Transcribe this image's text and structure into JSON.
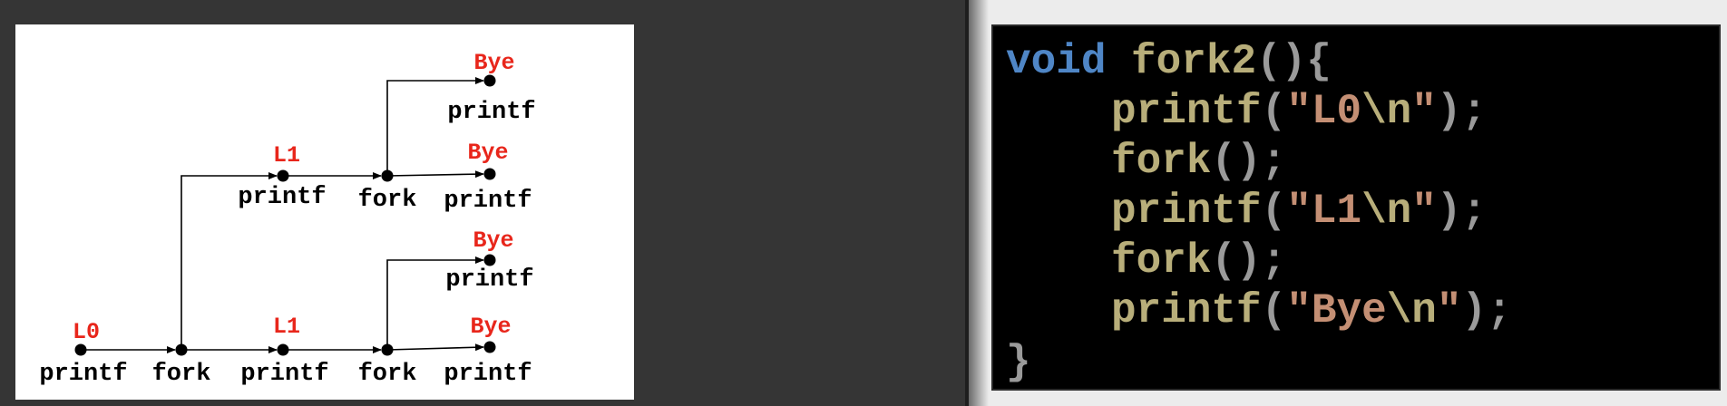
{
  "diagram": {
    "nodes": [
      {
        "id": "n0",
        "label": "printf",
        "output": "L0"
      },
      {
        "id": "n1",
        "label": "fork",
        "output": ""
      },
      {
        "id": "n2",
        "label": "printf",
        "output": "L1"
      },
      {
        "id": "n3",
        "label": "fork",
        "output": ""
      },
      {
        "id": "n4",
        "label": "printf",
        "output": "Bye"
      },
      {
        "id": "n5",
        "label": "printf",
        "output": "Bye"
      },
      {
        "id": "n6",
        "label": "printf",
        "output": "L1"
      },
      {
        "id": "n7",
        "label": "fork",
        "output": ""
      },
      {
        "id": "n8",
        "label": "printf",
        "output": "Bye"
      },
      {
        "id": "n9",
        "label": "printf",
        "output": "Bye"
      }
    ],
    "edges": [
      {
        "from": "n0",
        "to": "n1"
      },
      {
        "from": "n1",
        "to": "n2"
      },
      {
        "from": "n2",
        "to": "n3"
      },
      {
        "from": "n3",
        "to": "n4"
      },
      {
        "from": "n3",
        "to": "n5"
      },
      {
        "from": "n1",
        "to": "n6"
      },
      {
        "from": "n6",
        "to": "n7"
      },
      {
        "from": "n7",
        "to": "n8"
      },
      {
        "from": "n7",
        "to": "n9"
      }
    ]
  },
  "code": {
    "keyword_void": "void",
    "func_name": "fork2",
    "parens": "()",
    "open_brace": "{",
    "printf": "printf",
    "fork": "fork",
    "lparen": "(",
    "rparen": ")",
    "empty_parens": "()",
    "semicolon": ";",
    "quote": "\"",
    "str_l0": "L0",
    "str_l1": "L1",
    "str_bye": "Bye",
    "escape_n": "\\n",
    "close_brace": "}"
  },
  "colors": {
    "output_text": "#e8261b",
    "keyword": "#4f86c6",
    "identifier": "#b8ae7a",
    "string": "#c48f74",
    "punctuation": "#9a9a9a"
  }
}
